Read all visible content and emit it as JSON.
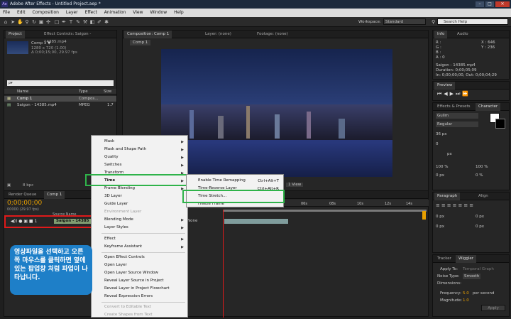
{
  "window": {
    "title": "Adobe After Effects - Untitled Project.aep *"
  },
  "menu": [
    "File",
    "Edit",
    "Composition",
    "Layer",
    "Effect",
    "Animation",
    "View",
    "Window",
    "Help"
  ],
  "toolbar": {
    "workspace_label": "Workspace:",
    "workspace_value": "Standard",
    "search_placeholder": "Search Help"
  },
  "project": {
    "tabs": [
      "Project",
      "Effect Controls: Saigon - 14385.mp4"
    ],
    "comp_name": "Comp 1 ▼",
    "comp_res": "1280 x 720 (1.00)",
    "comp_dur": "Δ 0;00;15;00, 29.97 fps",
    "search_placeholder": "ρ▾",
    "col_name": "Name",
    "col_type": "Type",
    "col_size": "Size",
    "items": [
      {
        "name": "Comp 1",
        "type": "Compos...",
        "size": ""
      },
      {
        "name": "Saigon - 14385.mp4",
        "type": "MPEG",
        "size": "1.7"
      }
    ],
    "bpc": "8 bpc"
  },
  "composition": {
    "tabs": [
      "Composition: Comp 1",
      "Layer: (none)",
      "Footage: (none)"
    ],
    "subtab": "Comp 1",
    "zoom": "(Full)",
    "view": "1 View"
  },
  "info": {
    "tabs": [
      "Info",
      "Audio"
    ],
    "r": "R :",
    "g": "G :",
    "b": "B :",
    "a": "A : 0",
    "x": "X : 646",
    "y": "Y : 236",
    "file": "Saigon - 14385.mp4",
    "duration": "Duration: 0;00;05;09",
    "in_out": "In: 0;00;00;00, Out: 0;00;04;29"
  },
  "preview": {
    "tab": "Preview"
  },
  "character": {
    "tabs": [
      "Effects & Presets",
      "Character"
    ],
    "font": "Gulim",
    "style": "Regular",
    "size": "36 px",
    "kerning": "0",
    "leading_unit": "px",
    "scale_v": "100 %",
    "scale_h": "100 %",
    "baseline": "0 px",
    "tsume": "0 %"
  },
  "paragraph": {
    "tabs": [
      "Paragraph",
      "Align"
    ],
    "indent": "0 px",
    "space": "0 px"
  },
  "wiggler": {
    "tabs": [
      "Tracker",
      "Wiggler"
    ],
    "apply_to": "Apply To:",
    "apply_value": "Temporal Graph",
    "noise": "Noise Type:",
    "noise_value": "Smooth",
    "dims": "Dimensions:",
    "freq_label": "Frequency:",
    "freq_value": "5.0",
    "freq_unit": "per second",
    "mag_label": "Magnitude:",
    "mag_value": "1.0",
    "apply_btn": "Apply"
  },
  "timeline": {
    "tabs": [
      "Render Queue",
      "Comp 1"
    ],
    "timecode": "0;00;00;00",
    "fps": "00000 (29.97 fps)",
    "col_source": "Source Name",
    "layer_name": "Saigon - 14385",
    "ruler": [
      "06s",
      "08s",
      "10s",
      "12s",
      "14s"
    ],
    "mode": "None"
  },
  "context_menu": {
    "items": [
      {
        "label": "Mask",
        "arrow": true,
        "disabled": false
      },
      {
        "label": "Mask and Shape Path",
        "arrow": true,
        "disabled": false
      },
      {
        "label": "Quality",
        "arrow": true,
        "disabled": false
      },
      {
        "label": "Switches",
        "arrow": true,
        "disabled": false
      },
      {
        "label": "Transform",
        "arrow": true,
        "disabled": false
      },
      {
        "label": "Time",
        "arrow": true,
        "disabled": false
      },
      {
        "label": "Frame Blending",
        "arrow": true,
        "disabled": false
      },
      {
        "label": "3D Layer",
        "arrow": false,
        "disabled": false
      },
      {
        "label": "Guide Layer",
        "arrow": false,
        "disabled": false
      },
      {
        "label": "Environment Layer",
        "arrow": false,
        "disabled": true
      },
      {
        "label": "Blending Mode",
        "arrow": true,
        "disabled": false
      },
      {
        "label": "Layer Styles",
        "arrow": true,
        "disabled": false
      },
      {
        "label": "Effect",
        "arrow": true,
        "disabled": false
      },
      {
        "label": "Keyframe Assistant",
        "arrow": true,
        "disabled": false
      },
      {
        "label": "Open Effect Controls",
        "arrow": false,
        "disabled": false
      },
      {
        "label": "Open Layer",
        "arrow": false,
        "disabled": false
      },
      {
        "label": "Open Layer Source Window",
        "arrow": false,
        "disabled": false
      },
      {
        "label": "Reveal Layer Source in Project",
        "arrow": false,
        "disabled": false
      },
      {
        "label": "Reveal Layer in Project Flowchart",
        "arrow": false,
        "disabled": false
      },
      {
        "label": "Reveal Expression Errors",
        "arrow": false,
        "disabled": false
      },
      {
        "label": "Convert to Editable Text",
        "arrow": false,
        "disabled": true
      },
      {
        "label": "Create Shapes from Text",
        "arrow": false,
        "disabled": true
      }
    ]
  },
  "submenu": {
    "items": [
      {
        "label": "Enable Time Remapping",
        "shortcut": "Ctrl+Alt+T"
      },
      {
        "label": "Time-Reverse Layer",
        "shortcut": "Ctrl+Alt+R"
      },
      {
        "label": "Time Stretch...",
        "shortcut": ""
      },
      {
        "label": "Freeze Frame",
        "shortcut": ""
      }
    ]
  },
  "callout": {
    "text": "영상파일을 선택하고 오른쪽 마우스를 클릭하면 옆에있는 팝업창 처럼 파업이 나타납니다."
  },
  "colors": {
    "accent": "#2fb34a",
    "highlight": "#e01a1a",
    "callout": "#1e7fc8",
    "timecode": "#e8a000"
  }
}
